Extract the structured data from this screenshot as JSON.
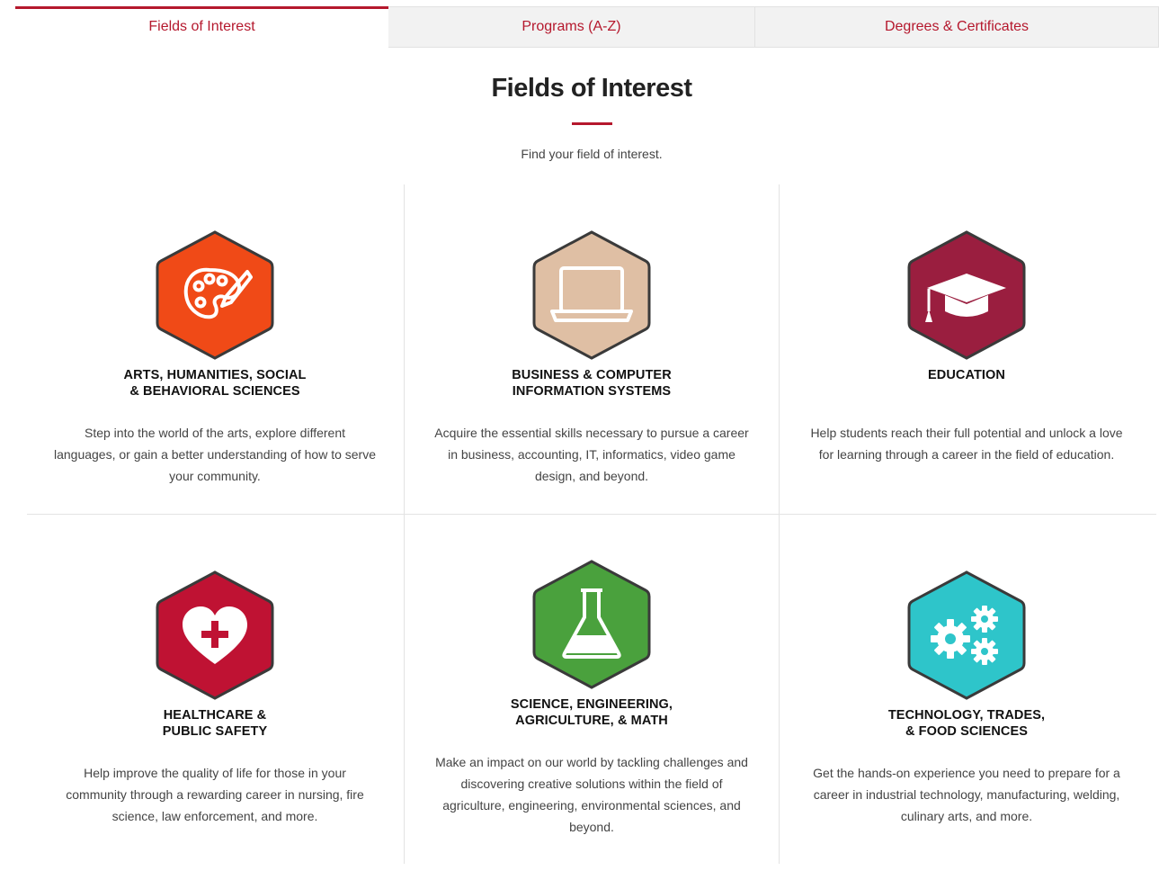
{
  "tabs": [
    {
      "label": "Fields of Interest",
      "active": true
    },
    {
      "label": "Programs (A-Z)",
      "active": false
    },
    {
      "label": "Degrees & Certificates",
      "active": false
    }
  ],
  "header": {
    "title": "Fields of Interest",
    "subtitle": "Find your field of interest."
  },
  "accent_color": "#b5182d",
  "cards": [
    {
      "icon": "palette-icon",
      "color": "#f04a17",
      "title_line1": "ARTS, HUMANITIES, SOCIAL",
      "title_line2": "& BEHAVIORAL SCIENCES",
      "description": "Step into the world of the arts, explore different languages, or gain a better understanding of how to serve your community."
    },
    {
      "icon": "laptop-icon",
      "color": "#dfbfa4",
      "title_line1": "BUSINESS & COMPUTER",
      "title_line2": "INFORMATION SYSTEMS",
      "description": "Acquire the essential skills necessary to pursue a career in business, accounting, IT, informatics, video game design, and beyond."
    },
    {
      "icon": "graduation-cap-icon",
      "color": "#9a1e3f",
      "title_line1": "EDUCATION",
      "title_line2": "",
      "description": "Help students reach their full potential and unlock a love for learning through a career in the field of education."
    },
    {
      "icon": "heart-cross-icon",
      "color": "#bf1233",
      "title_line1": "HEALTHCARE &",
      "title_line2": "PUBLIC SAFETY",
      "description": "Help improve the quality of life for those in your community through a rewarding career in nursing, fire science, law enforcement, and more."
    },
    {
      "icon": "flask-icon",
      "color": "#4aa13d",
      "title_line1": "SCIENCE, ENGINEERING,",
      "title_line2": "AGRICULTURE, & MATH",
      "description": "Make an impact on our world by tackling challenges and discovering creative solutions within the field of agriculture, engineering, environmental sciences, and beyond."
    },
    {
      "icon": "gears-icon",
      "color": "#2ec5ca",
      "title_line1": "TECHNOLOGY, TRADES,",
      "title_line2": "& FOOD SCIENCES",
      "description": "Get the hands-on experience you need to prepare for a career in industrial technology, manufacturing, welding, culinary arts, and more."
    }
  ]
}
